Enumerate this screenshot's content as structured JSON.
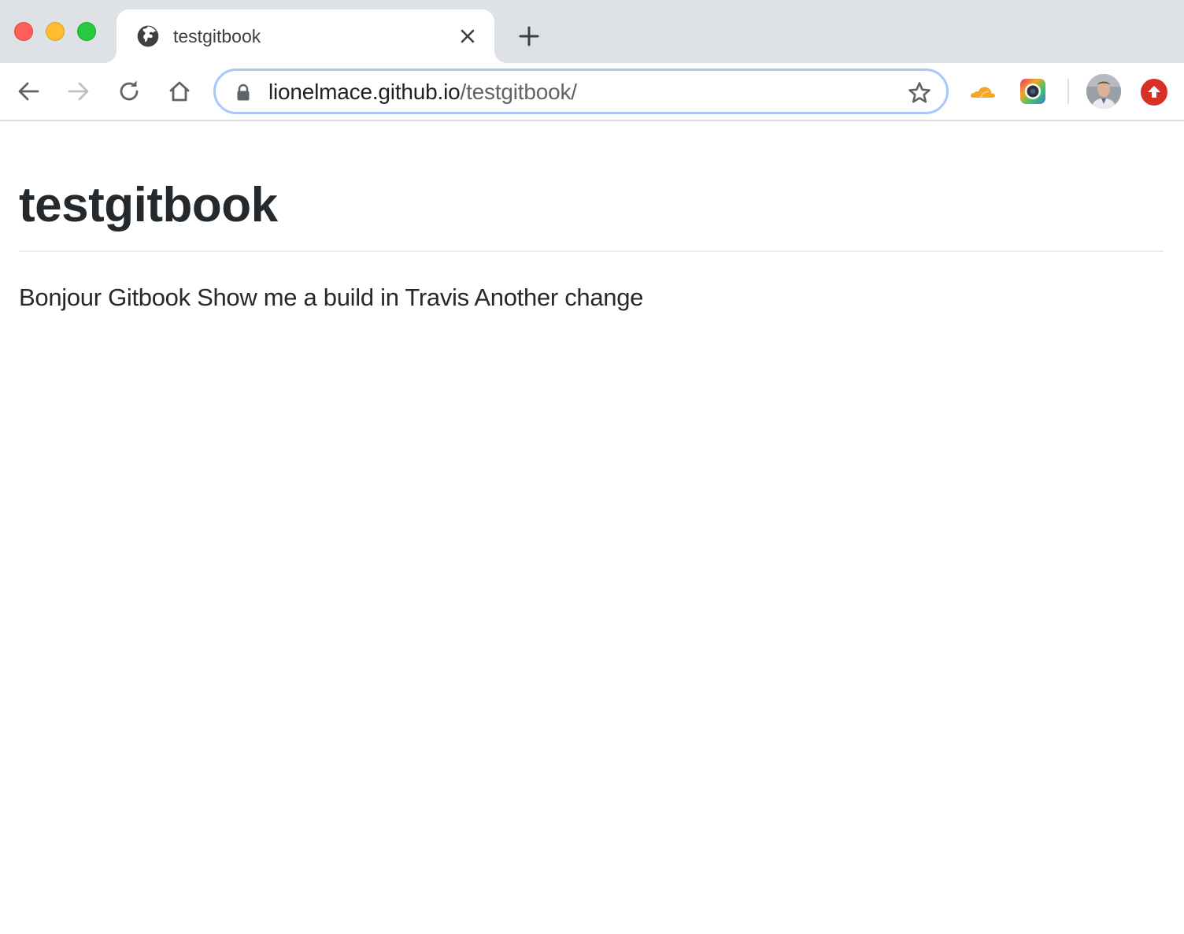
{
  "browser": {
    "tab": {
      "title": "testgitbook"
    },
    "address_bar": {
      "url_host": "lionelmace.github.io",
      "url_path": "/testgitbook/"
    },
    "icons": {
      "favicon": "globe-icon",
      "close_tab": "close-icon",
      "new_tab": "plus-icon",
      "back": "arrow-left-icon",
      "forward": "arrow-right-icon",
      "reload": "reload-icon",
      "home": "home-icon",
      "lock": "lock-icon",
      "bookmark": "star-icon",
      "extensions": [
        "cloud-icon",
        "camera-icon"
      ],
      "update": "update-arrow-icon"
    },
    "colors": {
      "tabstrip": "#dee1e6",
      "omnibox_focus": "#a8c7fa",
      "update_badge": "#d93025",
      "cloud_extension": "#f6a623"
    }
  },
  "page": {
    "title": "testgitbook",
    "body_text": "Bonjour Gitbook Show me a build in Travis Another change"
  }
}
